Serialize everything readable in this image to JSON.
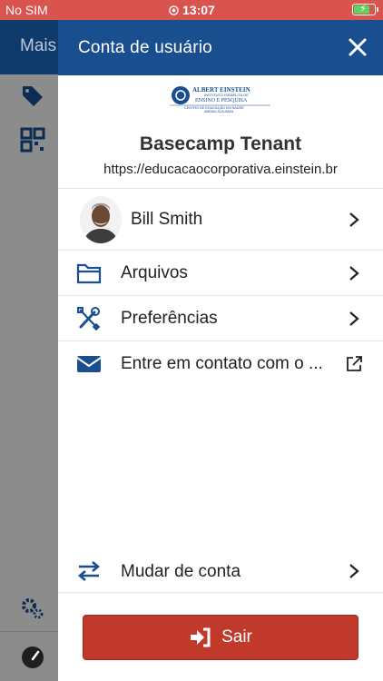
{
  "status_bar": {
    "carrier": "No SIM",
    "time": "13:07"
  },
  "background_app": {
    "header_title": "Mais"
  },
  "drawer": {
    "title": "Conta de usuário",
    "logo": {
      "line1": "ALBERT EINSTEIN",
      "line2": "INSTITUTO ISRAELITA DE",
      "line3": "ENSINO E PESQUISA",
      "line4": "CENTRO DE EDUCAÇÃO EM SAÚDE",
      "line5": "ABRAM SZAJMAN"
    },
    "tenant_name": "Basecamp Tenant",
    "tenant_url": "https://educacaocorporativa.einstein.br",
    "user_name": "Bill Smith",
    "menu": [
      {
        "label": "Arquivos",
        "icon": "folder-icon"
      },
      {
        "label": "Preferências",
        "icon": "tools-icon"
      },
      {
        "label": "Entre em contato com o ...",
        "icon": "envelope-icon"
      }
    ],
    "switch_account": "Mudar de conta",
    "logout": "Sair"
  },
  "colors": {
    "status_bar": "#d9534f",
    "header": "#1a4f8f",
    "icon_blue": "#1a4f8f",
    "logout_red": "#c0392b"
  }
}
